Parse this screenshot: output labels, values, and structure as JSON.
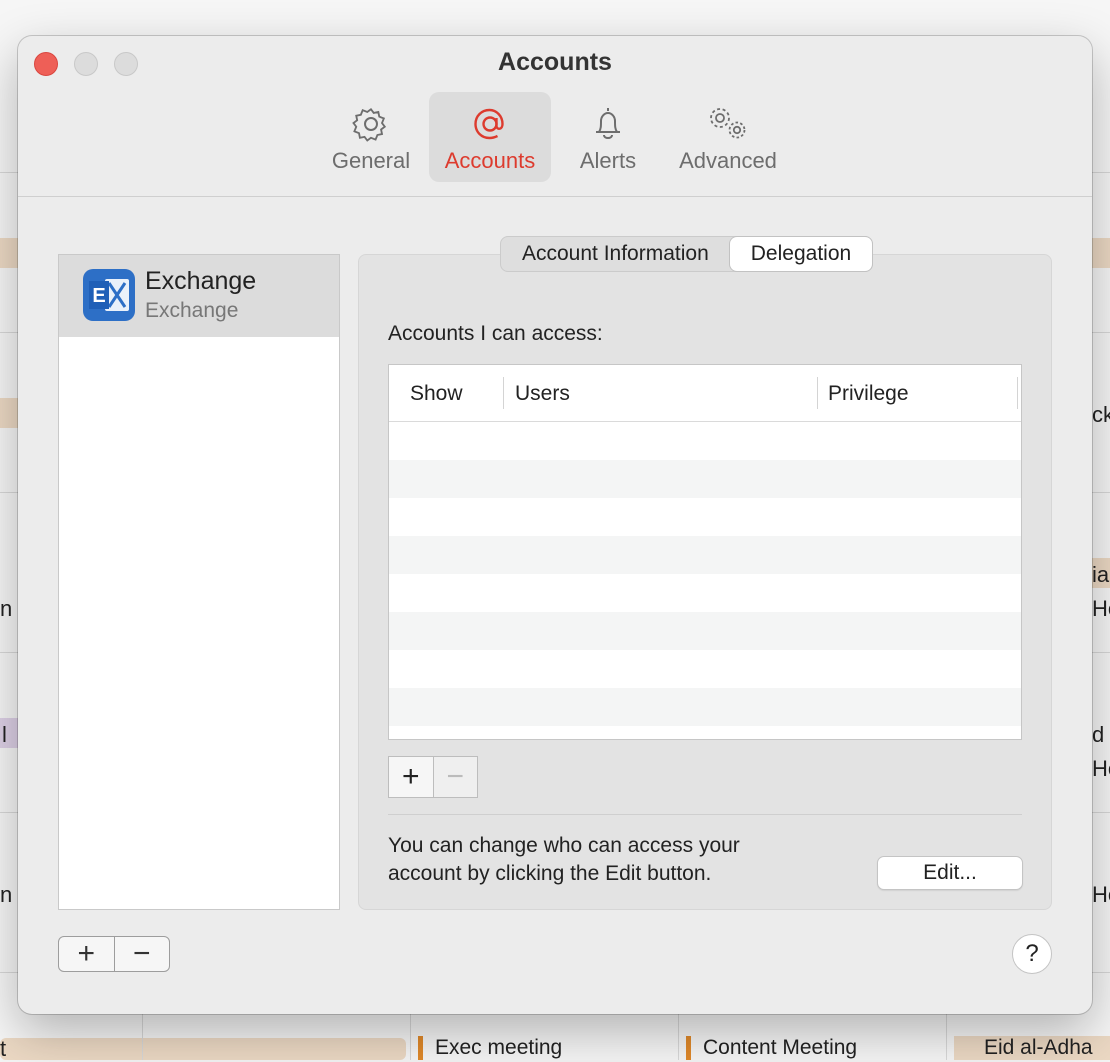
{
  "window": {
    "title": "Accounts"
  },
  "toolbar": {
    "items": [
      {
        "label": "General",
        "icon": "gear-icon"
      },
      {
        "label": "Accounts",
        "icon": "at-sign-icon"
      },
      {
        "label": "Alerts",
        "icon": "bell-icon"
      },
      {
        "label": "Advanced",
        "icon": "gears-icon"
      }
    ],
    "active": "Accounts",
    "active_color": "#dd3b2e"
  },
  "accounts": {
    "items": [
      {
        "name": "Exchange",
        "type": "Exchange",
        "icon": "exchange-logo-icon"
      }
    ],
    "add_label": "+",
    "remove_label": "−"
  },
  "tabs": {
    "items": [
      "Account Information",
      "Delegation"
    ],
    "active": "Delegation"
  },
  "delegation": {
    "section_label": "Accounts I can access:",
    "columns": [
      "Show",
      "Users",
      "Privilege"
    ],
    "rows": [],
    "add_label": "+",
    "remove_label": "−",
    "info_line1": "You can change who can access your",
    "info_line2": "account by clicking the Edit button.",
    "edit_label": "Edit..."
  },
  "help": {
    "label": "?"
  },
  "background": {
    "events": [
      {
        "label": "Exec meeting"
      },
      {
        "label": "Content Meeting"
      },
      {
        "label": "Eid al-Adha"
      }
    ],
    "fragments": [
      "ck",
      "ia",
      "He",
      "d",
      "He",
      "He",
      "n",
      "n",
      "l",
      "t"
    ]
  }
}
